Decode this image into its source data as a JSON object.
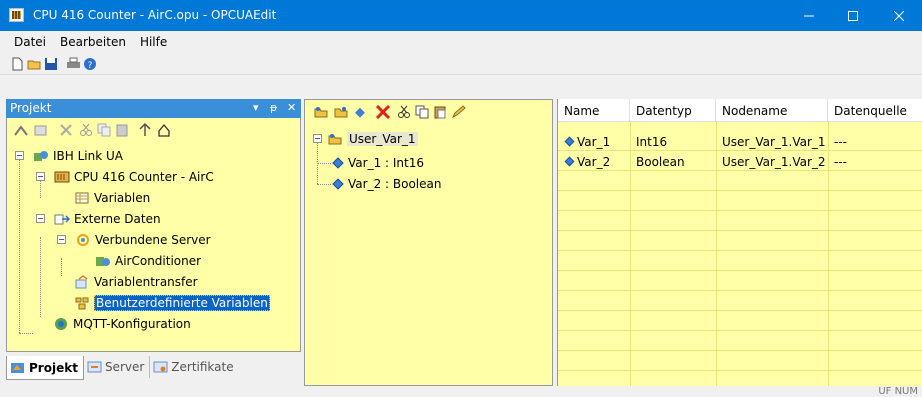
{
  "window": {
    "title": "CPU 416 Counter - AirC.opu - OPCUAEdit",
    "controls": [
      "minimize",
      "maximize",
      "close"
    ]
  },
  "menu": {
    "items": [
      "Datei",
      "Bearbeiten",
      "Hilfe"
    ]
  },
  "toolbar": {
    "icons": [
      "new-file-icon",
      "open-folder-icon",
      "save-icon",
      "print-icon",
      "help-icon"
    ]
  },
  "left_panel": {
    "title": "Projekt",
    "header_buttons": [
      "▾",
      "ᵽ",
      "✕"
    ],
    "tree": [
      {
        "label": "IBH Link UA",
        "level": 0,
        "expanded": true,
        "icon": "network-device-icon"
      },
      {
        "label": "CPU 416 Counter - AirC",
        "level": 1,
        "expanded": true,
        "icon": "plc-icon"
      },
      {
        "label": "Variablen",
        "level": 2,
        "icon": "table-icon"
      },
      {
        "label": "Externe Daten",
        "level": 1,
        "expanded": true,
        "icon": "external-data-icon"
      },
      {
        "label": "Verbundene Server",
        "level": 2,
        "expanded": true,
        "icon": "server-link-icon"
      },
      {
        "label": "AirConditioner",
        "level": 3,
        "icon": "server-icon"
      },
      {
        "label": "Variablentransfer",
        "level": 2,
        "icon": "transfer-icon"
      },
      {
        "label": "Benutzerdefinierte Variablen",
        "level": 2,
        "icon": "user-variables-icon",
        "selected": true
      },
      {
        "label": "MQTT-Konfiguration",
        "level": 1,
        "icon": "mqtt-icon"
      }
    ],
    "tabs": [
      {
        "label": "Projekt",
        "active": true
      },
      {
        "label": "Server",
        "active": false
      },
      {
        "label": "Zertifikate",
        "active": false
      }
    ]
  },
  "middle_panel": {
    "tree": [
      {
        "label": "User_Var_1",
        "level": 0,
        "expanded": true
      },
      {
        "label": "Var_1 : Int16",
        "level": 1
      },
      {
        "label": "Var_2 : Boolean",
        "level": 1
      }
    ]
  },
  "right_panel": {
    "columns": [
      "Name",
      "Datentyp",
      "Nodename",
      "Datenquelle"
    ],
    "rows": [
      {
        "name": "Var_1",
        "type": "Int16",
        "node": "User_Var_1.Var_1",
        "source": "---"
      },
      {
        "name": "Var_2",
        "type": "Boolean",
        "node": "User_Var_1.Var_2",
        "source": "---"
      }
    ]
  },
  "status": {
    "text": "UF NUM"
  },
  "colors": {
    "titlebar": "#0078d7",
    "panel_bg": "#ffffa8",
    "selection": "#0a64c8",
    "panel_header": "#3b8fd8"
  }
}
